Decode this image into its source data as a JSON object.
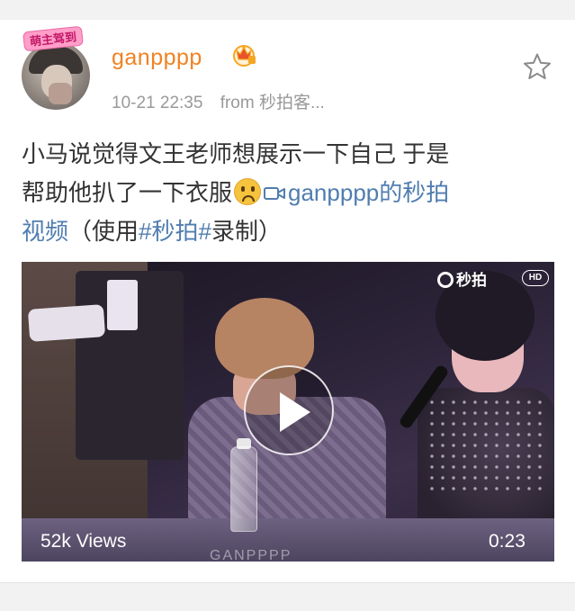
{
  "post": {
    "avatar_badge": "萌主驾到",
    "username": "ganpppp",
    "timestamp": "10-21 22:35",
    "source": "from 秒拍客...",
    "text": {
      "line1": "小马说觉得文王老师想展示一下自己 于是",
      "line2_prefix": "帮助他扒了一下衣服",
      "video_link": "ganpppp的秒拍",
      "line3_link": "视频",
      "line3_paren_open": "（使用",
      "hashtag": "#秒拍#",
      "line3_paren_close": "录制）"
    },
    "video": {
      "views": "52k Views",
      "duration": "0:23",
      "logo_text": "秒拍",
      "hd_badge": "HD",
      "watermark": "GANPPPP"
    }
  },
  "colors": {
    "username": "#f08222",
    "link": "#507daf",
    "body_text": "#333333",
    "meta_text": "#999999"
  },
  "icons": [
    "vip-crown-icon",
    "star-icon",
    "video-link-icon",
    "emoji-upside-down-face-icon",
    "play-icon",
    "miaopai-logo-icon"
  ]
}
